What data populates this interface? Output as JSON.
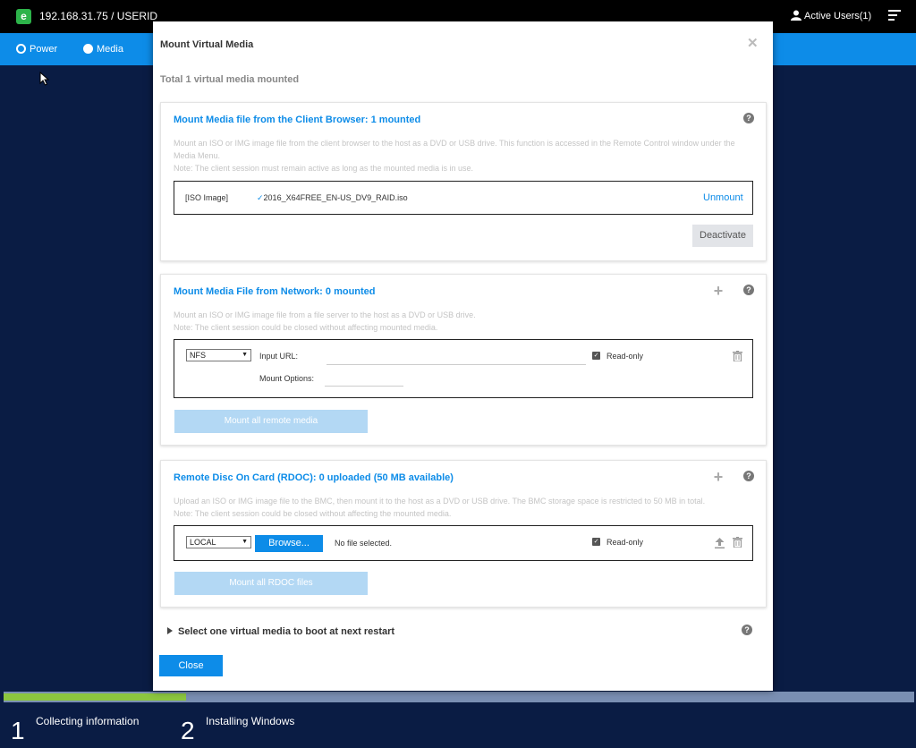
{
  "topbar": {
    "title": "192.168.31.75 / USERID",
    "active_users": "Active Users(1)"
  },
  "nav": {
    "items": [
      {
        "label": "Power",
        "icon": "power-icon"
      },
      {
        "label": "Media",
        "icon": "media-icon"
      }
    ]
  },
  "modal": {
    "title": "Mount Virtual Media",
    "summary": "Total 1 virtual media mounted",
    "client_panel": {
      "title": "Mount Media file from the Client Browser: 1 mounted",
      "description_line1": "Mount an ISO or IMG image file from the client browser to the host as a DVD or USB drive. This function is accessed in the Remote Control window under the Media Menu.",
      "description_line2": "Note: The client session must remain active as long as the mounted media is in use.",
      "media_type": "[ISO Image]",
      "file_name": "2016_X64FREE_EN-US_DV9_RAID.iso",
      "unmount_label": "Unmount",
      "deactivate_label": "Deactivate"
    },
    "network_panel": {
      "title": "Mount Media File from Network: 0 mounted",
      "description_line1": "Mount an ISO or IMG image file from a file server to the host as a DVD or USB drive.",
      "description_line2": "Note: The client session could be closed without affecting mounted media.",
      "protocol": "NFS",
      "input_url_label": "Input URL:",
      "input_url_value": "",
      "mount_options_label": "Mount Options:",
      "mount_options_value": "",
      "readonly_label": "Read-only",
      "readonly_checked": true,
      "mount_all_label": "Mount all remote media"
    },
    "rdoc_panel": {
      "title": "Remote Disc On Card (RDOC): 0 uploaded (50 MB available)",
      "description_line1": "Upload an ISO or IMG image file to the BMC, then mount it to the host as a DVD or USB drive. The BMC storage space is restricted to 50 MB in total.",
      "description_line2": "Note: The client session could be closed without affecting the mounted media.",
      "source": "LOCAL",
      "browse_label": "Browse...",
      "file_status": "No file selected.",
      "readonly_label": "Read-only",
      "readonly_checked": true,
      "mount_all_label": "Mount all RDOC files"
    },
    "boot_label": "Select one virtual media to boot at next restart",
    "close_label": "Close"
  },
  "setup": {
    "progress": 0.2,
    "steps": [
      {
        "number": "1",
        "label": "Collecting information"
      },
      {
        "number": "2",
        "label": "Installing Windows"
      }
    ]
  },
  "colors": {
    "accent": "#0d8ce8",
    "topbar": "#000000",
    "desktop": "#0a1c44",
    "progress_fill": "#8cc63f",
    "logo": "#2db34a"
  }
}
